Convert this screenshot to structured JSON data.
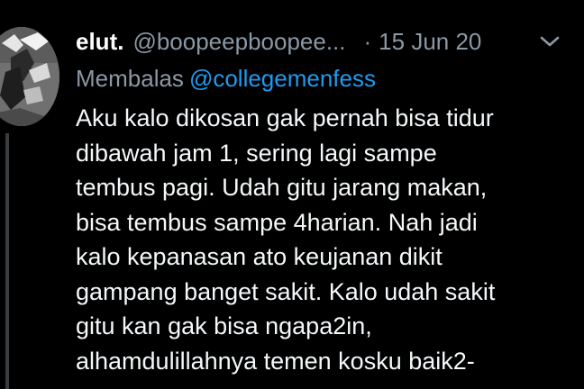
{
  "tweet": {
    "author": {
      "display_name": "elut.",
      "handle": "@boopeepboopee...",
      "avatar_icon": "profile-photo"
    },
    "separator": "·",
    "date": "15 Jun 20",
    "menu_icon": "chevron-down-icon",
    "reply_to": {
      "label": "Membalas",
      "mention": "@collegemenfess"
    },
    "text_lines": [
      "Aku kalo dikosan gak pernah bisa tidur",
      "dibawah jam 1, sering lagi sampe",
      "tembus pagi. Udah gitu jarang makan,",
      "bisa tembus sampe 4harian. Nah jadi",
      "kalo kepanasan ato keujanan dikit",
      "gampang banget sakit. Kalo udah sakit",
      "gitu kan gak bisa ngapa2in,",
      "alhamdulillahnya temen kosku baik2-"
    ]
  },
  "colors": {
    "background": "#000000",
    "text": "#f5f8fa",
    "secondary_text": "#8b98a5",
    "mention": "#1d9bf0",
    "thread_line": "#3a3d40"
  }
}
